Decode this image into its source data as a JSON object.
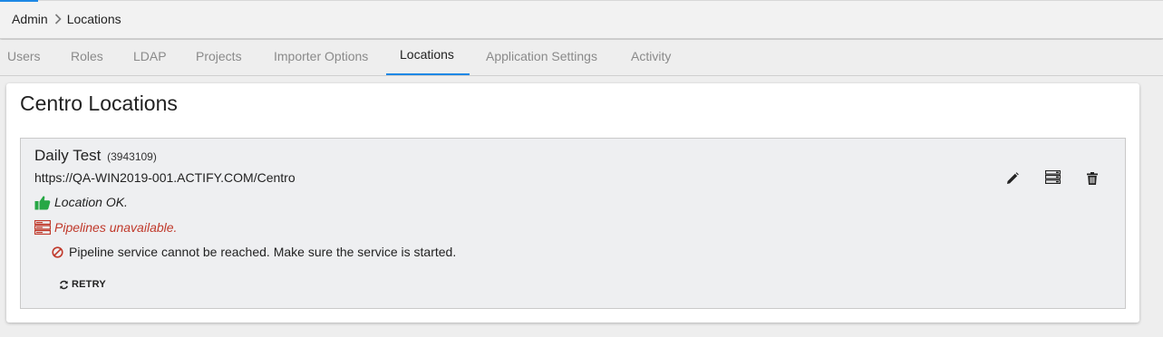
{
  "breadcrumb": {
    "root": "Admin",
    "current": "Locations"
  },
  "tabs": [
    {
      "label": "Users"
    },
    {
      "label": "Roles"
    },
    {
      "label": "LDAP"
    },
    {
      "label": "Projects"
    },
    {
      "label": "Importer Options"
    },
    {
      "label": "Locations",
      "active": true
    },
    {
      "label": "Application Settings"
    },
    {
      "label": "Activity"
    }
  ],
  "page": {
    "title": "Centro Locations"
  },
  "location": {
    "name": "Daily Test",
    "id": "(3943109)",
    "url": "https://QA-WIN2019-001.ACTIFY.COM/Centro",
    "status_ok": "Location OK.",
    "status_pipelines": "Pipelines unavailable.",
    "error_message": "Pipeline service cannot be reached. Make sure the service is started.",
    "retry_label": "RETRY"
  },
  "icons": {
    "thumbs_up": "thumbs-up-icon",
    "server": "server-icon",
    "ban": "ban-icon",
    "refresh": "refresh-icon",
    "edit": "pencil-icon",
    "pipelines": "server-icon",
    "delete": "trash-icon"
  },
  "colors": {
    "accent": "#1e88e5",
    "ok_green": "#27a745",
    "error_red": "#c0392b"
  }
}
